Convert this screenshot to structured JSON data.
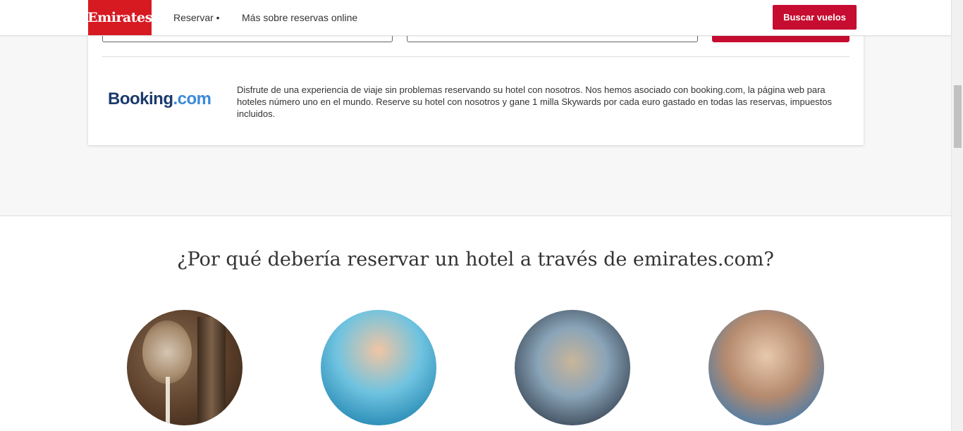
{
  "header": {
    "logo_text": "Emirates",
    "nav": [
      {
        "label": "Reservar •"
      },
      {
        "label": "Más sobre reservas online"
      }
    ],
    "search_button": "Buscar vuelos"
  },
  "booking_partner": {
    "logo_part1": "Booking",
    "logo_part2": ".com",
    "description": "Disfrute de una experiencia de viaje sin problemas reservando su hotel con nosotros. Nos hemos asociado con booking.com, la página web para hoteles número uno en el mundo. Reserve su hotel con nosotros y gane 1 milla Skywards por cada euro gastado en todas las reservas, impuestos incluidos."
  },
  "why_section": {
    "title": "¿Por qué debería reservar un hotel a través de emirates.com?",
    "images": [
      {
        "icon": "hotel-room-image"
      },
      {
        "icon": "pool-family-image"
      },
      {
        "icon": "laptop-woman-image"
      },
      {
        "icon": "friends-phone-image"
      }
    ]
  },
  "colors": {
    "brand_red": "#d71921",
    "button_red": "#c60c30",
    "booking_dark": "#1b3a6b",
    "booking_light": "#3b8ad8"
  }
}
